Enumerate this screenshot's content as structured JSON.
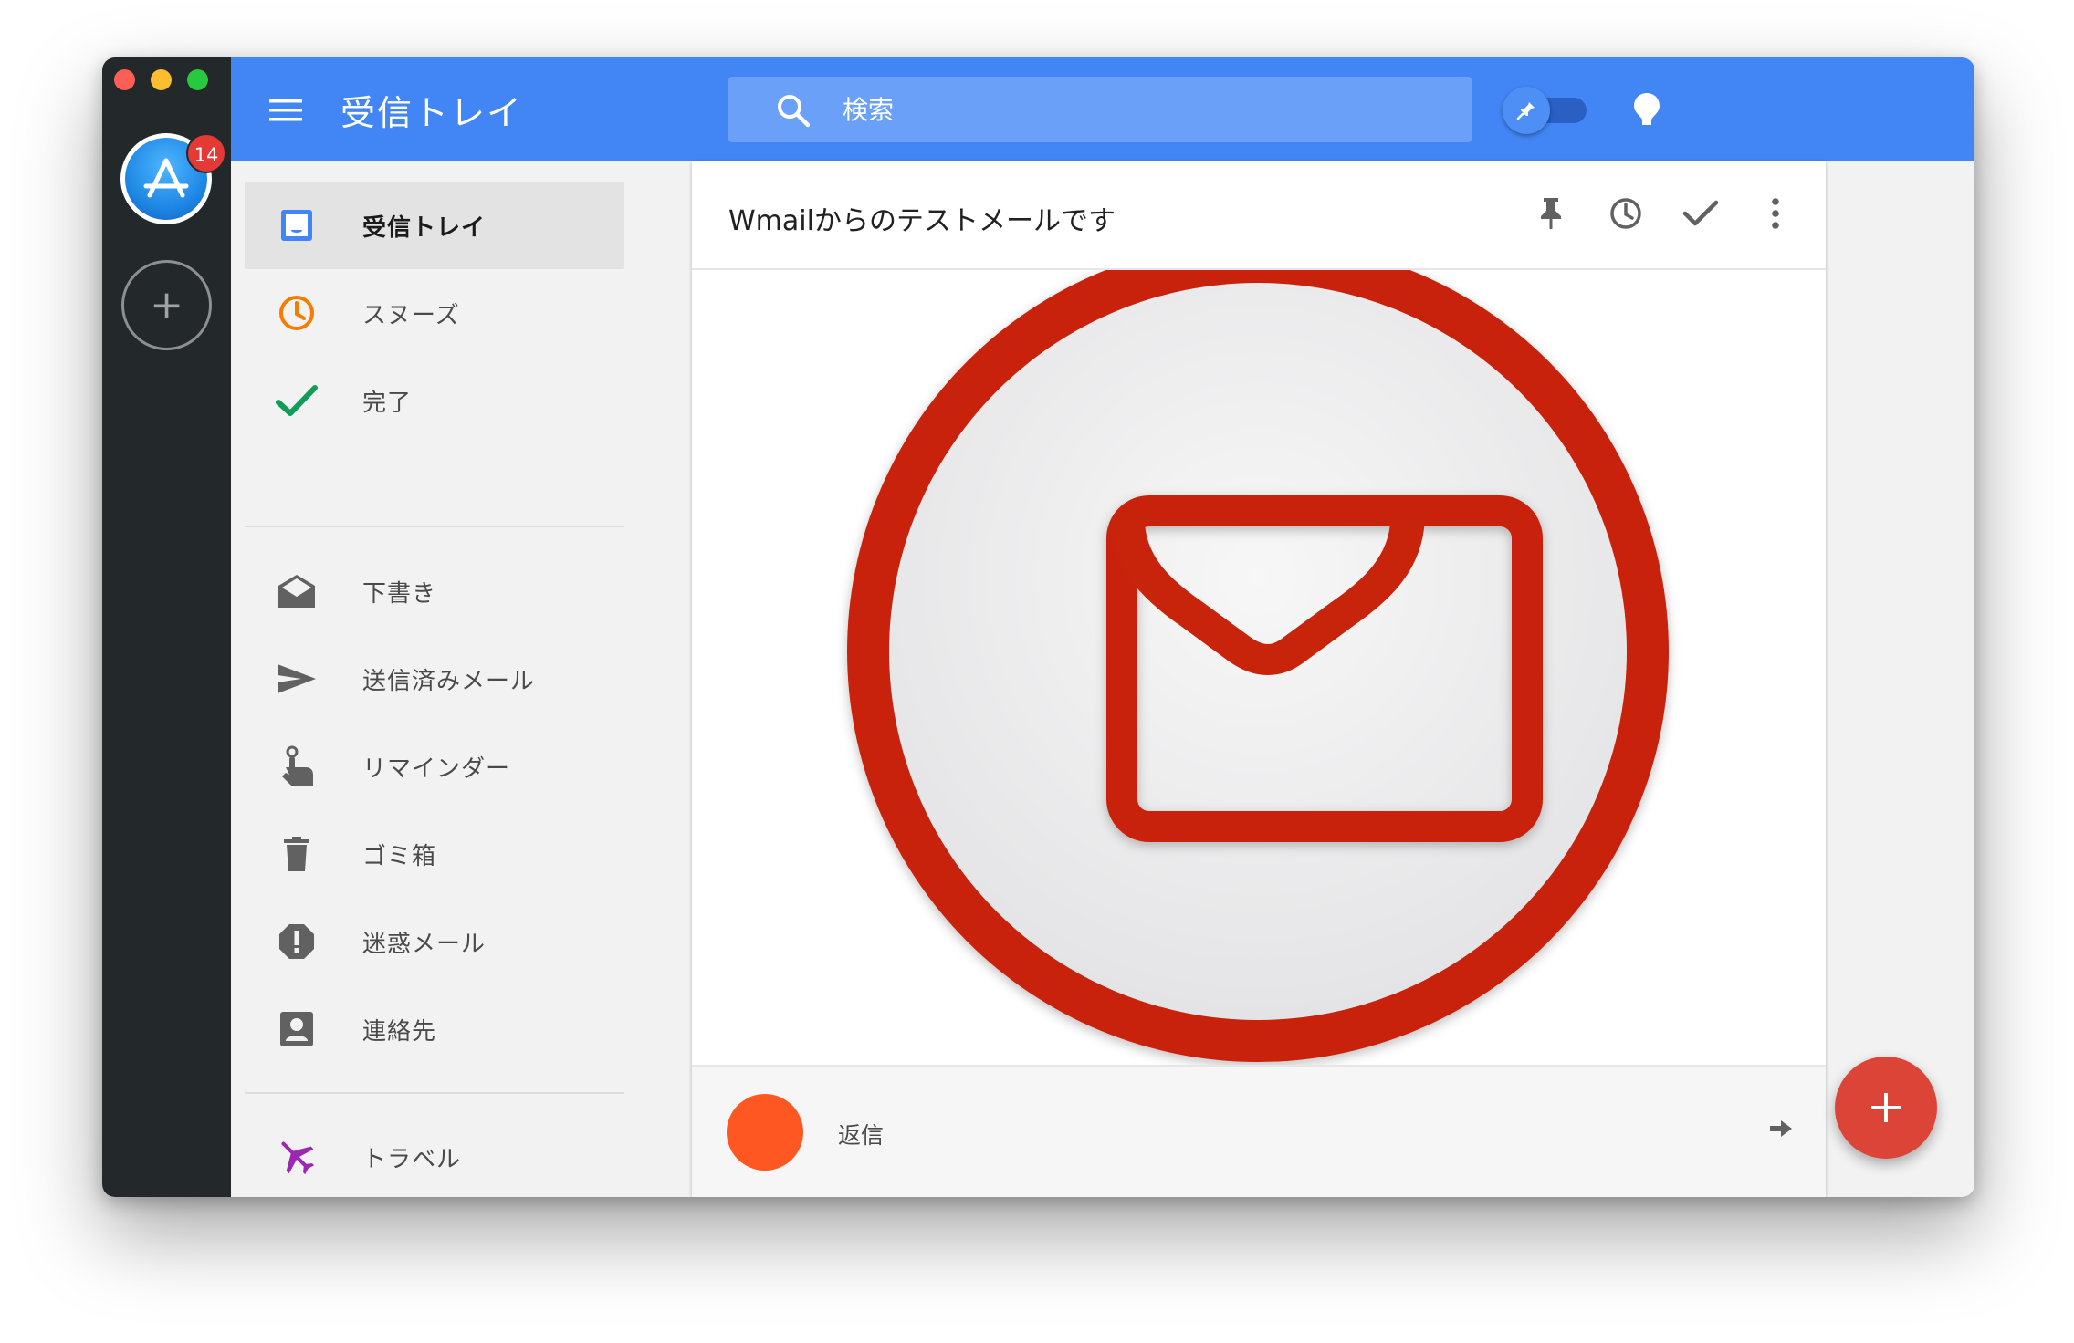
{
  "window": {
    "controls": [
      "close",
      "minimize",
      "maximize"
    ]
  },
  "accounts": {
    "primary": {
      "icon": "app-store-icon",
      "unread_badge": "14"
    },
    "add_label": "+"
  },
  "header": {
    "title": "受信トレイ",
    "search": {
      "placeholder": "検索"
    },
    "pin_toggle": {
      "on": true
    },
    "colors": {
      "background": "#4285f4"
    }
  },
  "sidebar": {
    "groups": [
      [
        {
          "id": "inbox",
          "label": "受信トレイ",
          "icon": "inbox-icon",
          "active": true
        },
        {
          "id": "snoozed",
          "label": "スヌーズ",
          "icon": "clock-icon",
          "active": false
        },
        {
          "id": "done",
          "label": "完了",
          "icon": "check-icon",
          "active": false
        }
      ],
      [
        {
          "id": "drafts",
          "label": "下書き",
          "icon": "draft-icon",
          "active": false
        },
        {
          "id": "sent",
          "label": "送信済みメール",
          "icon": "send-icon",
          "active": false
        },
        {
          "id": "reminders",
          "label": "リマインダー",
          "icon": "reminder-icon",
          "active": false
        },
        {
          "id": "trash",
          "label": "ゴミ箱",
          "icon": "trash-icon",
          "active": false
        },
        {
          "id": "spam",
          "label": "迷惑メール",
          "icon": "spam-icon",
          "active": false
        },
        {
          "id": "contacts",
          "label": "連絡先",
          "icon": "contact-icon",
          "active": false
        }
      ],
      [
        {
          "id": "travel",
          "label": "トラベル",
          "icon": "airplane-icon",
          "active": false
        }
      ]
    ]
  },
  "message": {
    "subject": "Wmailからのテストメールです",
    "actions": [
      "pin-icon",
      "snooze-icon",
      "done-icon",
      "more-icon"
    ],
    "body_image": "mail-envelope-icon",
    "reply": {
      "label": "返信",
      "avatar_color": "#ff5722"
    }
  },
  "fab": {
    "label": "+",
    "color": "#db4437"
  }
}
